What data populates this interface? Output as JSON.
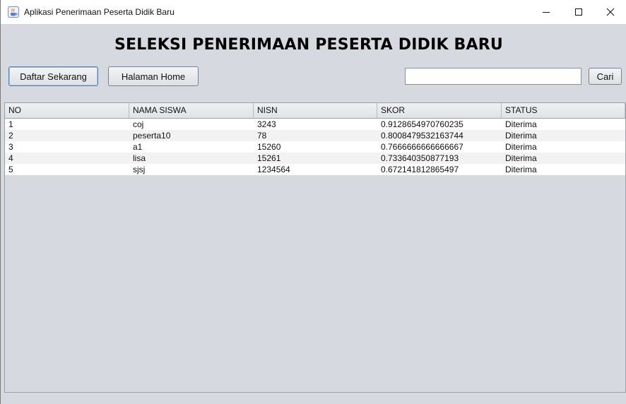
{
  "window": {
    "title": "Aplikasi Penerimaan Peserta Didik Baru",
    "icon": "java-cup-icon"
  },
  "heading": "SELEKSI PENERIMAAN PESERTA DIDIK BARU",
  "buttons": {
    "daftar": "Daftar Sekarang",
    "home": "Halaman Home",
    "cari": "Cari"
  },
  "search": {
    "value": "",
    "placeholder": ""
  },
  "table": {
    "columns": [
      "NO",
      "NAMA SISWA",
      "NISN",
      "SKOR",
      "STATUS"
    ],
    "rows": [
      [
        "1",
        "coj",
        "3243",
        "0.9128654970760235",
        "Diterima"
      ],
      [
        "2",
        "peserta10",
        "78",
        "0.8008479532163744",
        "Diterima"
      ],
      [
        "3",
        "a1",
        "15260",
        "0.7666666666666667",
        "Diterima"
      ],
      [
        "4",
        "lisa",
        "15261",
        "0.733640350877193",
        "Diterima"
      ],
      [
        "5",
        "sjsj",
        "1234564",
        "0.672141812865497",
        "Diterima"
      ]
    ]
  },
  "colors": {
    "window_bg": "#d6d9df",
    "titlebar_bg": "#ffffff",
    "row_alt": "#f2f2f2"
  }
}
